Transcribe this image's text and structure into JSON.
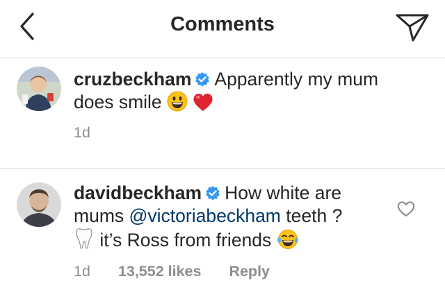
{
  "header": {
    "title": "Comments"
  },
  "comments": [
    {
      "username": "cruzbeckham",
      "text_part1": "Apparently my mum",
      "text_part2": "does smile",
      "time": "1d"
    },
    {
      "username": "davidbeckham",
      "text_part1": "How white are",
      "text_part2": "mums",
      "mention": "@victoriabeckham",
      "text_part3": "teeth ?",
      "text_part4": "it’s Ross from friends",
      "time": "1d",
      "likes": "13,552 likes",
      "reply_label": "Reply"
    }
  ],
  "colors": {
    "text": "#262626",
    "meta": "#8e8e8e",
    "mention": "#00376b",
    "verified": "#3897f0",
    "divider": "#dbdbdb"
  },
  "icons": {
    "back": "chevron-left-icon",
    "share": "paper-plane-icon",
    "verified": "verified-badge-icon",
    "like": "heart-outline-icon"
  }
}
